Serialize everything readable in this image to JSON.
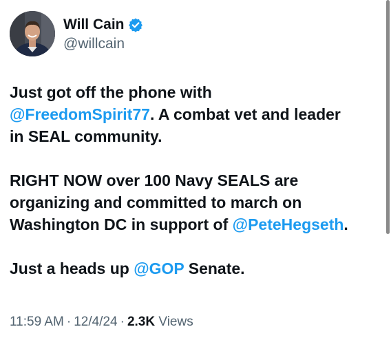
{
  "author": {
    "display_name": "Will Cain",
    "handle": "@willcain",
    "verified": true
  },
  "tweet": {
    "line1_a": "Just got off the phone with",
    "line2_mention": "@FreedomSpirit77",
    "line2_rest": ". A combat vet and leader",
    "line3": "in SEAL community.",
    "line4": "RIGHT NOW over 100 Navy SEALS are",
    "line5": "organizing and committed to march on",
    "line6_a": "Washington DC in support of ",
    "line6_mention": "@PeteHegseth",
    "line6_end": ".",
    "line7_a": "Just a heads up ",
    "line7_mention": "@GOP",
    "line7_end": " Senate."
  },
  "meta": {
    "time": "11:59 AM",
    "sep1": "·",
    "date": "12/4/24",
    "sep2": "·",
    "views_count": "2.3K",
    "views_label": "Views"
  },
  "colors": {
    "link": "#1d9bf0",
    "secondary_text": "#536471",
    "primary_text": "#0f1419",
    "verified_badge": "#1d9bf0"
  },
  "icons": {
    "verified": "verified-badge-icon"
  }
}
